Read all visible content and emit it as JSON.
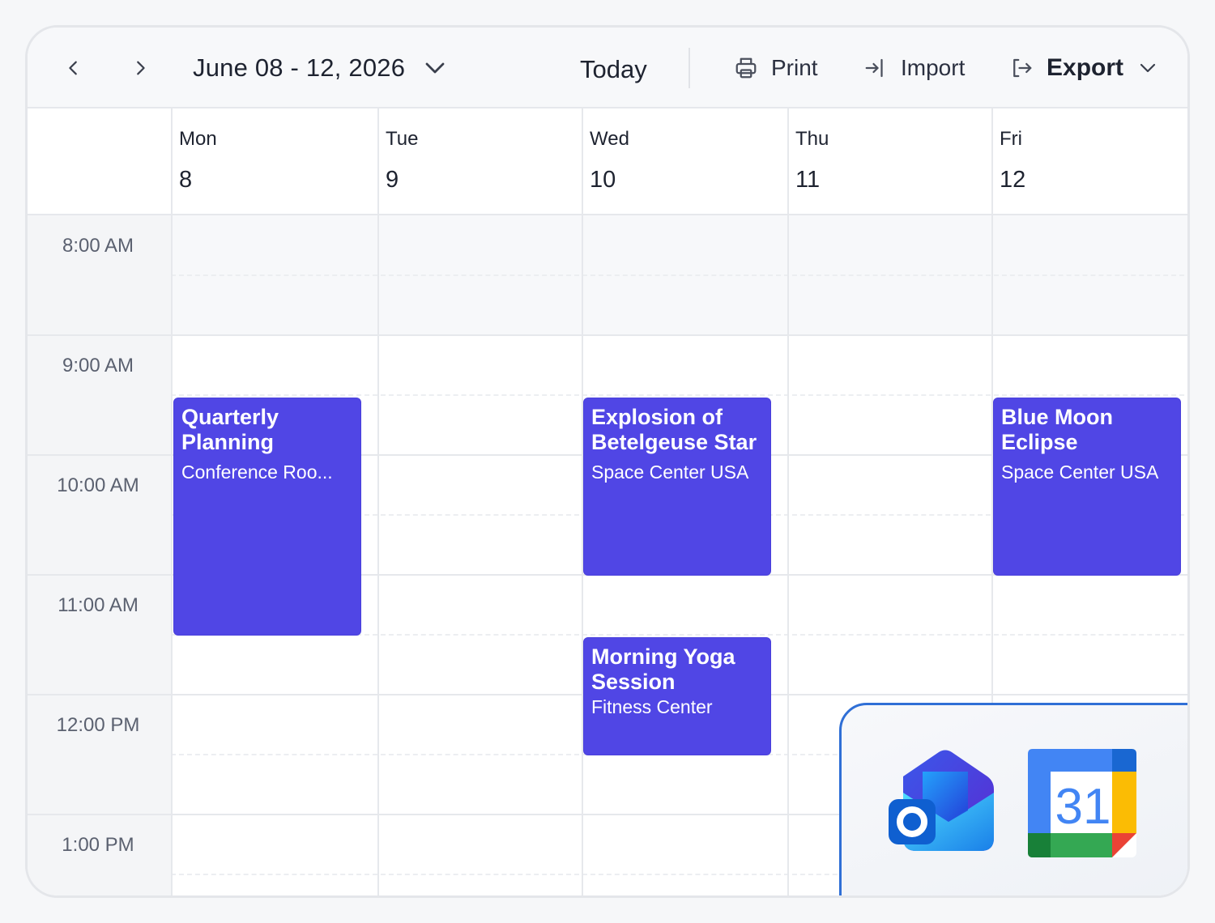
{
  "toolbar": {
    "prev_icon": "chevron-left-icon",
    "next_icon": "chevron-right-icon",
    "range_label": "June 08 - 12, 2026",
    "today_label": "Today",
    "print_label": "Print",
    "import_label": "Import",
    "export_label": "Export"
  },
  "days": [
    {
      "dow": "Mon",
      "num": "8"
    },
    {
      "dow": "Tue",
      "num": "9"
    },
    {
      "dow": "Wed",
      "num": "10"
    },
    {
      "dow": "Thu",
      "num": "11"
    },
    {
      "dow": "Fri",
      "num": "12"
    }
  ],
  "times": [
    "8:00 AM",
    "9:00 AM",
    "10:00 AM",
    "11:00 AM",
    "12:00 PM",
    "1:00 PM"
  ],
  "events": [
    {
      "title": "Quarterly Planning",
      "location": "Conference Roo...",
      "day": "Mon",
      "start": "9:30 AM",
      "end": "11:30 AM"
    },
    {
      "title": "Explosion of Betelgeuse Star",
      "location": "Space Center USA",
      "day": "Wed",
      "start": "9:30 AM",
      "end": "11:00 AM"
    },
    {
      "title": "Blue Moon Eclipse",
      "location": "Space Center USA",
      "day": "Fri",
      "start": "9:30 AM",
      "end": "11:00 AM"
    },
    {
      "title": "Morning Yoga Session",
      "location": "Fitness Center",
      "day": "Wed",
      "start": "11:30 AM",
      "end": "12:30 PM"
    }
  ],
  "integrations": {
    "outlook_icon": "outlook-icon",
    "google_calendar_icon": "google-calendar-icon",
    "google_calendar_number": "31"
  },
  "colors": {
    "event": "#5046E5",
    "overlay_border": "#2F6FD6"
  }
}
